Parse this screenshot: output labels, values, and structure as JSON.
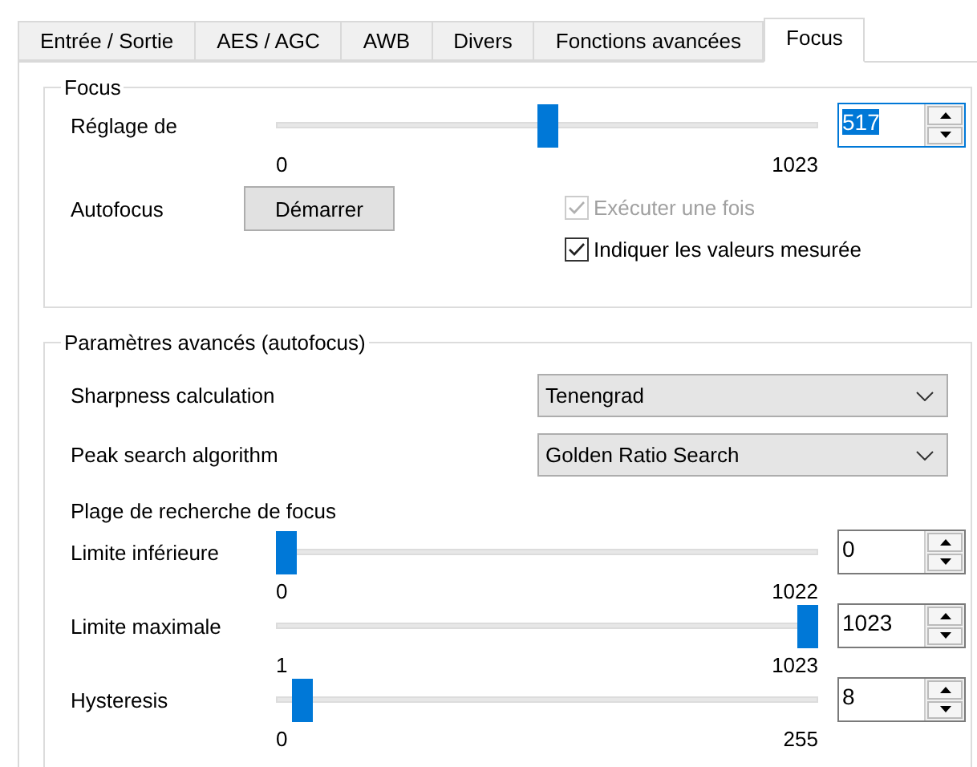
{
  "tabs": [
    {
      "label": "Entrée / Sortie",
      "selected": false
    },
    {
      "label": "AES / AGC",
      "selected": false
    },
    {
      "label": "AWB",
      "selected": false
    },
    {
      "label": "Divers",
      "selected": false
    },
    {
      "label": "Fonctions avancées",
      "selected": false
    },
    {
      "label": "Focus",
      "selected": true
    }
  ],
  "focus_group": {
    "title": "Focus",
    "slider": {
      "label": "Réglage de",
      "level": 0.5,
      "min": "0",
      "max": "1023",
      "value": "517",
      "focused": true
    },
    "autofocus": {
      "label": "Autofocus",
      "button": "Démarrer"
    },
    "checkboxes": [
      {
        "label": "Exécuter une fois",
        "checked": true,
        "disabled": true
      },
      {
        "label": "Indiquer les valeurs mesurée",
        "checked": true,
        "disabled": false
      }
    ]
  },
  "advanced_group": {
    "title": "Paramètres avancés (autofocus)",
    "dropdowns": [
      {
        "label": "Sharpness calculation",
        "value": "Tenengrad"
      },
      {
        "label": "Peak search algorithm",
        "value": "Golden Ratio Search"
      }
    ],
    "range_label": "Plage de recherche de focus",
    "sliders": [
      {
        "label": "Limite inférieure",
        "level": 0,
        "min": "0",
        "max": "1022",
        "value": "0",
        "focused": false
      },
      {
        "label": "Limite maximale",
        "level": 1,
        "min": "1",
        "max": "1023",
        "value": "1023",
        "focused": false
      },
      {
        "label": "Hysteresis",
        "level": 0.03,
        "min": "0",
        "max": "255",
        "value": "8",
        "focused": false
      }
    ]
  }
}
